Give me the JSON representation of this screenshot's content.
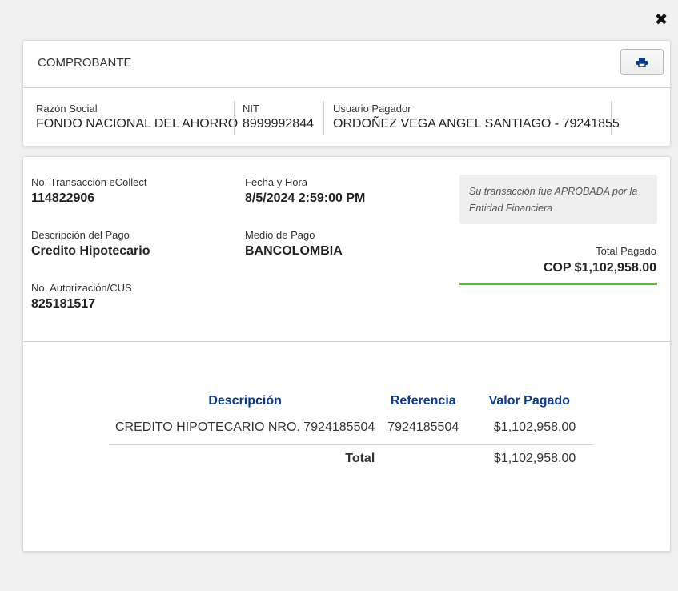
{
  "close_icon": "close-icon",
  "header": {
    "title": "COMPROBANTE",
    "print_icon": "print-icon"
  },
  "company": {
    "razon_social_label": "Razón Social",
    "razon_social": "FONDO NACIONAL DEL AHORRO",
    "nit_label": "NIT",
    "nit": "8999992844",
    "usuario_label": "Usuario Pagador",
    "usuario": "ORDOÑEZ VEGA ANGEL SANTIAGO - 79241855"
  },
  "transaction": {
    "no_transaccion_label": "No. Transacción eCollect",
    "no_transaccion": "114822906",
    "fecha_label": "Fecha y Hora",
    "fecha": "8/5/2024 2:59:00 PM",
    "descripcion_label": "Descripción del Pago",
    "descripcion": "Credito Hipotecario",
    "medio_label": "Medio de Pago",
    "medio": "BANCOLOMBIA",
    "autorizacion_label": "No. Autorización/CUS",
    "autorizacion": "825181517",
    "status_message": "Su transacción fue APROBADA por la Entidad Financiera",
    "total_label": "Total Pagado",
    "total": "COP $1,102,958.00",
    "status_color": "#5bbd2b"
  },
  "detail": {
    "headers": [
      "Descripción",
      "Referencia",
      "Valor Pagado"
    ],
    "rows": [
      {
        "descripcion": "CREDITO HIPOTECARIO NRO. 7924185504",
        "referencia": "7924185504",
        "valor": "$1,102,958.00"
      }
    ],
    "total_label": "Total",
    "total_value": "$1,102,958.00"
  }
}
